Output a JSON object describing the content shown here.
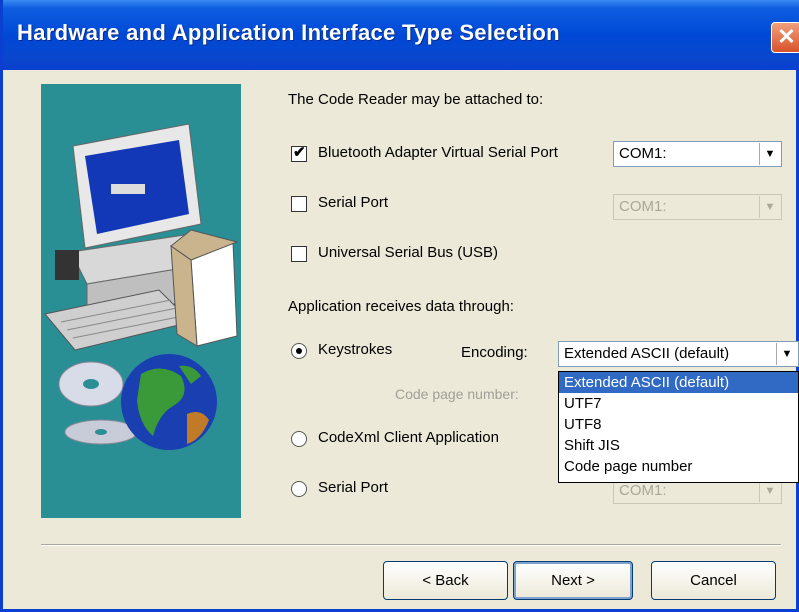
{
  "window": {
    "title": "Hardware and Application Interface Type Selection",
    "close_icon": "close-icon"
  },
  "attach": {
    "heading": "The Code Reader may be attached to:",
    "bluetooth": {
      "label": "Bluetooth Adapter Virtual Serial Port",
      "checked": true,
      "port": "COM1:"
    },
    "serial": {
      "label": "Serial Port",
      "checked": false,
      "port": "COM1:"
    },
    "usb": {
      "label": "Universal Serial Bus (USB)",
      "checked": false
    }
  },
  "app": {
    "heading": "Application receives data through:",
    "keystrokes": {
      "label": "Keystrokes",
      "selected": true
    },
    "encoding_label": "Encoding:",
    "encoding_value": "Extended ASCII (default)",
    "code_page_label": "Code page number:",
    "codexml": {
      "label": "CodeXml Client Application",
      "selected": false
    },
    "serial_port": {
      "label": "Serial Port",
      "selected": false,
      "port": "COM1:"
    }
  },
  "encoding_options": [
    "Extended ASCII (default)",
    "UTF7",
    "UTF8",
    "Shift JIS",
    "Code page number"
  ],
  "buttons": {
    "back": "< Back",
    "next": "Next >",
    "cancel": "Cancel"
  },
  "colors": {
    "title_bar": "#0049d6",
    "art_bg": "#2a8e95",
    "selection": "#316ac5",
    "dialog_bg": "#ece9d8"
  }
}
